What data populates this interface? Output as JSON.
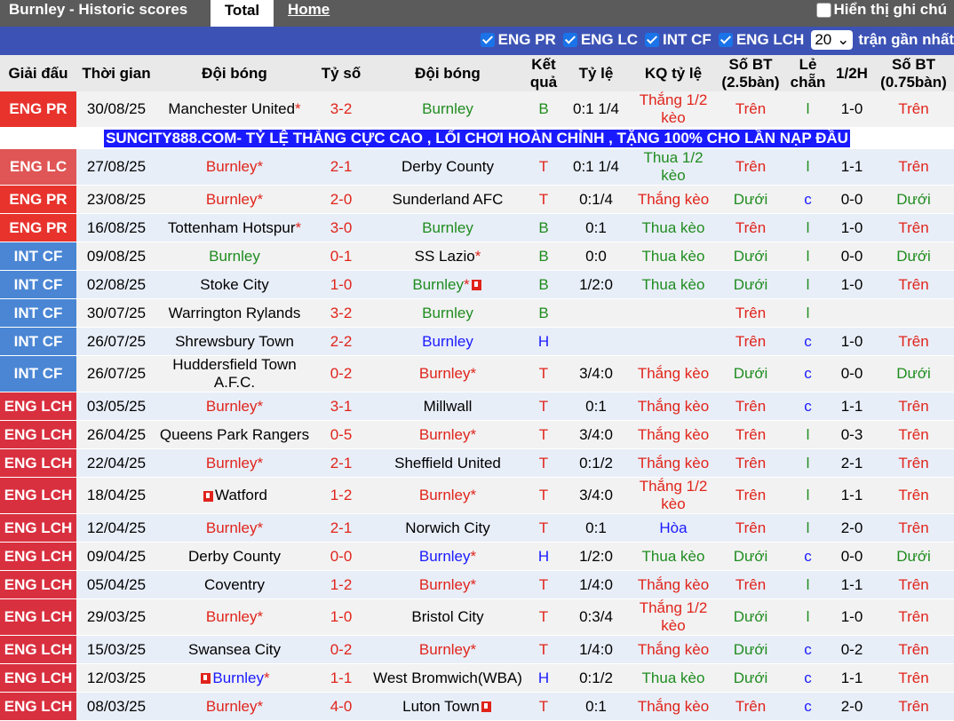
{
  "topbar": {
    "title": "Burnley - Historic scores",
    "tab_total": "Total",
    "tab_home": "Home",
    "show_label": "Hiển thị ghi chú"
  },
  "filters": {
    "items": [
      "ENG PR",
      "ENG LC",
      "INT CF",
      "ENG LCH"
    ],
    "count": "20",
    "recent_label": "trận gần nhất"
  },
  "headers": [
    "Giải đấu",
    "Thời gian",
    "Đội bóng",
    "Tỷ số",
    "Đội bóng",
    "Kết quả",
    "Tỷ lệ",
    "KQ tỷ lệ",
    "Số BT (2.5bàn)",
    "Lẻ chẵn",
    "1/2H",
    "Số BT (0.75bàn)"
  ],
  "ad_text": "SUNCITY888.COM- TỶ LỆ THẮNG CỰC CAO , LỐI CHƠI HOÀN CHỈNH , TẶNG 100% CHO LẦN NẠP ĐẦU",
  "colors": {
    "ENG PR": "#e8332d",
    "ENG LC": "#e05555",
    "INT CF": "#4a86d4",
    "ENG LCH": "#d9303f"
  },
  "rows": [
    {
      "league": "ENG PR",
      "date": "30/08/25",
      "home": "Manchester United",
      "home_star": "*",
      "home_color": "",
      "score": "3-2",
      "away": "Burnley",
      "away_star": "",
      "away_color": "green",
      "result": "B",
      "odds": "0:1 1/4",
      "odds_res": "Thắng 1/2 kèo",
      "odds_res_color": "red",
      "ou": "Trên",
      "ou_color": "red",
      "oe": "l",
      "ht": "1-0",
      "ou2": "Trên",
      "ou2_color": "red"
    },
    {
      "ad": true
    },
    {
      "league": "ENG LC",
      "date": "27/08/25",
      "home": "Burnley",
      "home_star": "*",
      "home_color": "red",
      "score": "2-1",
      "away": "Derby County",
      "away_star": "",
      "away_color": "",
      "result": "T",
      "odds": "0:1 1/4",
      "odds_res": "Thua 1/2 kèo",
      "odds_res_color": "green",
      "ou": "Trên",
      "ou_color": "red",
      "oe": "l",
      "ht": "1-1",
      "ou2": "Trên",
      "ou2_color": "red"
    },
    {
      "league": "ENG PR",
      "date": "23/08/25",
      "home": "Burnley",
      "home_star": "*",
      "home_color": "red",
      "score": "2-0",
      "away": "Sunderland AFC",
      "away_star": "",
      "away_color": "",
      "result": "T",
      "odds": "0:1/4",
      "odds_res": "Thắng kèo",
      "odds_res_color": "red",
      "ou": "Dưới",
      "ou_color": "green",
      "oe": "c",
      "ht": "0-0",
      "ou2": "Dưới",
      "ou2_color": "green"
    },
    {
      "league": "ENG PR",
      "date": "16/08/25",
      "home": "Tottenham Hotspur",
      "home_star": "*",
      "home_color": "",
      "score": "3-0",
      "away": "Burnley",
      "away_star": "",
      "away_color": "green",
      "result": "B",
      "odds": "0:1",
      "odds_res": "Thua kèo",
      "odds_res_color": "green",
      "ou": "Trên",
      "ou_color": "red",
      "oe": "l",
      "ht": "1-0",
      "ou2": "Trên",
      "ou2_color": "red"
    },
    {
      "league": "INT CF",
      "date": "09/08/25",
      "home": "Burnley",
      "home_star": "",
      "home_color": "green",
      "score": "0-1",
      "away": "SS Lazio",
      "away_star": "*",
      "away_color": "",
      "result": "B",
      "odds": "0:0",
      "odds_res": "Thua kèo",
      "odds_res_color": "green",
      "ou": "Dưới",
      "ou_color": "green",
      "oe": "l",
      "ht": "0-0",
      "ou2": "Dưới",
      "ou2_color": "green"
    },
    {
      "league": "INT CF",
      "date": "02/08/25",
      "home": "Stoke City",
      "home_star": "",
      "home_color": "",
      "score": "1-0",
      "away": "Burnley",
      "away_star": "*",
      "away_color": "green",
      "away_flag": "after",
      "result": "B",
      "odds": "1/2:0",
      "odds_res": "Thua kèo",
      "odds_res_color": "green",
      "ou": "Dưới",
      "ou_color": "green",
      "oe": "l",
      "ht": "1-0",
      "ou2": "Trên",
      "ou2_color": "red"
    },
    {
      "league": "INT CF",
      "date": "30/07/25",
      "home": "Warrington Rylands",
      "home_star": "",
      "home_color": "",
      "score": "3-2",
      "away": "Burnley",
      "away_star": "",
      "away_color": "green",
      "result": "B",
      "odds": "",
      "odds_res": "",
      "odds_res_color": "",
      "ou": "Trên",
      "ou_color": "red",
      "oe": "l",
      "ht": "",
      "ou2": "",
      "ou2_color": ""
    },
    {
      "league": "INT CF",
      "date": "26/07/25",
      "home": "Shrewsbury Town",
      "home_star": "",
      "home_color": "",
      "score": "2-2",
      "away": "Burnley",
      "away_star": "",
      "away_color": "blue",
      "result": "H",
      "odds": "",
      "odds_res": "",
      "odds_res_color": "",
      "ou": "Trên",
      "ou_color": "red",
      "oe": "c",
      "ht": "1-0",
      "ou2": "Trên",
      "ou2_color": "red"
    },
    {
      "league": "INT CF",
      "date": "26/07/25",
      "home": "Huddersfield Town A.F.C.",
      "home_star": "",
      "home_color": "",
      "score": "0-2",
      "away": "Burnley",
      "away_star": "*",
      "away_color": "red",
      "result": "T",
      "odds": "3/4:0",
      "odds_res": "Thắng kèo",
      "odds_res_color": "red",
      "ou": "Dưới",
      "ou_color": "green",
      "oe": "c",
      "ht": "0-0",
      "ou2": "Dưới",
      "ou2_color": "green"
    },
    {
      "league": "ENG LCH",
      "date": "03/05/25",
      "home": "Burnley",
      "home_star": "*",
      "home_color": "red",
      "score": "3-1",
      "away": "Millwall",
      "away_star": "",
      "away_color": "",
      "result": "T",
      "odds": "0:1",
      "odds_res": "Thắng kèo",
      "odds_res_color": "red",
      "ou": "Trên",
      "ou_color": "red",
      "oe": "c",
      "ht": "1-1",
      "ou2": "Trên",
      "ou2_color": "red"
    },
    {
      "league": "ENG LCH",
      "date": "26/04/25",
      "home": "Queens Park Rangers",
      "home_star": "",
      "home_color": "",
      "score": "0-5",
      "away": "Burnley",
      "away_star": "*",
      "away_color": "red",
      "result": "T",
      "odds": "3/4:0",
      "odds_res": "Thắng kèo",
      "odds_res_color": "red",
      "ou": "Trên",
      "ou_color": "red",
      "oe": "l",
      "ht": "0-3",
      "ou2": "Trên",
      "ou2_color": "red"
    },
    {
      "league": "ENG LCH",
      "date": "22/04/25",
      "home": "Burnley",
      "home_star": "*",
      "home_color": "red",
      "score": "2-1",
      "away": "Sheffield United",
      "away_star": "",
      "away_color": "",
      "result": "T",
      "odds": "0:1/2",
      "odds_res": "Thắng kèo",
      "odds_res_color": "red",
      "ou": "Trên",
      "ou_color": "red",
      "oe": "l",
      "ht": "2-1",
      "ou2": "Trên",
      "ou2_color": "red"
    },
    {
      "league": "ENG LCH",
      "date": "18/04/25",
      "home": "Watford",
      "home_star": "",
      "home_color": "",
      "home_flag": "before",
      "score": "1-2",
      "away": "Burnley",
      "away_star": "*",
      "away_color": "red",
      "result": "T",
      "odds": "3/4:0",
      "odds_res": "Thắng 1/2 kèo",
      "odds_res_color": "red",
      "ou": "Trên",
      "ou_color": "red",
      "oe": "l",
      "ht": "1-1",
      "ou2": "Trên",
      "ou2_color": "red"
    },
    {
      "league": "ENG LCH",
      "date": "12/04/25",
      "home": "Burnley",
      "home_star": "*",
      "home_color": "red",
      "score": "2-1",
      "away": "Norwich City",
      "away_star": "",
      "away_color": "",
      "result": "T",
      "odds": "0:1",
      "odds_res": "Hòa",
      "odds_res_color": "blue",
      "ou": "Trên",
      "ou_color": "red",
      "oe": "l",
      "ht": "2-0",
      "ou2": "Trên",
      "ou2_color": "red"
    },
    {
      "league": "ENG LCH",
      "date": "09/04/25",
      "home": "Derby County",
      "home_star": "",
      "home_color": "",
      "score": "0-0",
      "away": "Burnley",
      "away_star": "*",
      "away_color": "blue",
      "result": "H",
      "odds": "1/2:0",
      "odds_res": "Thua kèo",
      "odds_res_color": "green",
      "ou": "Dưới",
      "ou_color": "green",
      "oe": "c",
      "ht": "0-0",
      "ou2": "Dưới",
      "ou2_color": "green"
    },
    {
      "league": "ENG LCH",
      "date": "05/04/25",
      "home": "Coventry",
      "home_star": "",
      "home_color": "",
      "score": "1-2",
      "away": "Burnley",
      "away_star": "*",
      "away_color": "red",
      "result": "T",
      "odds": "1/4:0",
      "odds_res": "Thắng kèo",
      "odds_res_color": "red",
      "ou": "Trên",
      "ou_color": "red",
      "oe": "l",
      "ht": "1-1",
      "ou2": "Trên",
      "ou2_color": "red"
    },
    {
      "league": "ENG LCH",
      "date": "29/03/25",
      "home": "Burnley",
      "home_star": "*",
      "home_color": "red",
      "score": "1-0",
      "away": "Bristol City",
      "away_star": "",
      "away_color": "",
      "result": "T",
      "odds": "0:3/4",
      "odds_res": "Thắng 1/2 kèo",
      "odds_res_color": "red",
      "ou": "Dưới",
      "ou_color": "green",
      "oe": "l",
      "ht": "1-0",
      "ou2": "Trên",
      "ou2_color": "red"
    },
    {
      "league": "ENG LCH",
      "date": "15/03/25",
      "home": "Swansea City",
      "home_star": "",
      "home_color": "",
      "score": "0-2",
      "away": "Burnley",
      "away_star": "*",
      "away_color": "red",
      "result": "T",
      "odds": "1/4:0",
      "odds_res": "Thắng kèo",
      "odds_res_color": "red",
      "ou": "Dưới",
      "ou_color": "green",
      "oe": "c",
      "ht": "0-2",
      "ou2": "Trên",
      "ou2_color": "red"
    },
    {
      "league": "ENG LCH",
      "date": "12/03/25",
      "home": "Burnley",
      "home_star": "*",
      "home_color": "blue",
      "home_flag": "before",
      "score": "1-1",
      "away": "West Bromwich(WBA)",
      "away_star": "",
      "away_color": "",
      "result": "H",
      "odds": "0:1/2",
      "odds_res": "Thua kèo",
      "odds_res_color": "green",
      "ou": "Dưới",
      "ou_color": "green",
      "oe": "c",
      "ht": "1-1",
      "ou2": "Trên",
      "ou2_color": "red"
    },
    {
      "league": "ENG LCH",
      "date": "08/03/25",
      "home": "Burnley",
      "home_star": "*",
      "home_color": "red",
      "score": "4-0",
      "away": "Luton Town",
      "away_star": "",
      "away_color": "",
      "away_flag": "after",
      "result": "T",
      "odds": "0:1",
      "odds_res": "Thắng kèo",
      "odds_res_color": "red",
      "ou": "Trên",
      "ou_color": "red",
      "oe": "c",
      "ht": "2-0",
      "ou2": "Trên",
      "ou2_color": "red"
    }
  ]
}
